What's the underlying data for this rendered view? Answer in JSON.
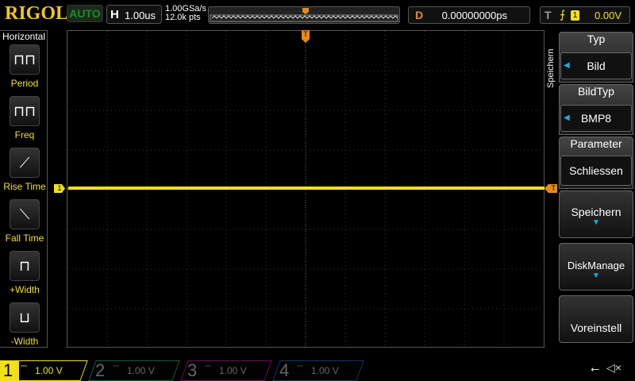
{
  "header": {
    "logo": "RIGOL",
    "mode": "AUTO",
    "h_key": "H",
    "timebase": "1.00us",
    "sample_rate": "1.00GSa/s",
    "memory_depth": "12.0k pts",
    "delay_key": "D",
    "delay": "0.00000000ps",
    "trigger_key": "T",
    "trigger_edge": "rising-edge-icon",
    "trigger_source": "1",
    "trigger_level": "0.00V",
    "trigger_marker": "T"
  },
  "left_panel": {
    "title": "Horizontal",
    "items": [
      {
        "label": "Period"
      },
      {
        "label": "Freq"
      },
      {
        "label": "Rise Time"
      },
      {
        "label": "Fall Time"
      },
      {
        "label": "+Width"
      },
      {
        "label": "-Width"
      }
    ]
  },
  "right_menu": {
    "tab": "Speichern",
    "items": [
      {
        "header": "Typ",
        "value": "Bild"
      },
      {
        "header": "BildTyp",
        "value": "BMP8"
      },
      {
        "header": "Parameter",
        "value": "Schliessen"
      },
      {
        "label": "Speichern"
      },
      {
        "label": "DiskManage"
      },
      {
        "label": "Voreinstell"
      }
    ]
  },
  "channels": [
    {
      "num": "1",
      "coupling": "⎓",
      "scale": "1.00 V",
      "color": "#f2e01a"
    },
    {
      "num": "2",
      "coupling": "⎓",
      "scale": "1.00 V",
      "color": "#1aa88a"
    },
    {
      "num": "3",
      "coupling": "⎓",
      "scale": "1.00 V",
      "color": "#c020a0"
    },
    {
      "num": "4",
      "coupling": "⎓",
      "scale": "1.00 V",
      "color": "#2060c0"
    }
  ],
  "markers": {
    "ch1": "1",
    "trig": "T"
  },
  "status": {
    "usb": "usb-icon",
    "sound": "mute-icon"
  }
}
